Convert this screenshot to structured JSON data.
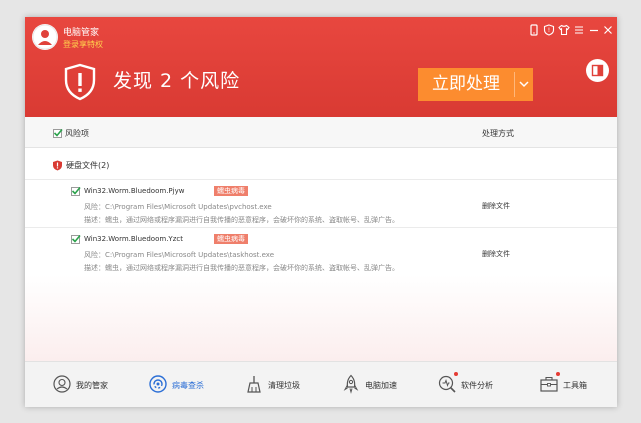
{
  "window": {
    "app_name": "电脑管家",
    "login_text": "登录享特权",
    "headline": "发现 2 个风险",
    "action_label": "立即处理"
  },
  "table": {
    "col_risk": "风险项",
    "col_action": "处理方式",
    "group_label": "硬盘文件(2)",
    "rows": [
      {
        "name": "Win32.Worm.Bluedoom.Pjyw",
        "badge": "蠕虫病毒",
        "path": "风险：C:\\Program Files\\Microsoft Updates\\pvchost.exe",
        "desc": "描述：蠕虫，通过网络或程序漏洞进行自我传播的恶意程序，会破坏你的系统、盗取帐号、乱弹广告。",
        "action": "删除文件",
        "checked": true
      },
      {
        "name": "Win32.Worm.Bluedoom.Yzct",
        "badge": "蠕虫病毒",
        "path": "风险：C:\\Program Files\\Microsoft Updates\\taskhost.exe",
        "desc": "描述：蠕虫，通过网络或程序漏洞进行自我传播的恶意程序，会破坏你的系统、盗取帐号、乱弹广告。",
        "action": "删除文件",
        "checked": true
      }
    ]
  },
  "nav": {
    "items": [
      {
        "label": "我的管家",
        "icon": "butler-icon"
      },
      {
        "label": "病毒查杀",
        "icon": "virus-scan-icon",
        "active": true
      },
      {
        "label": "清理垃圾",
        "icon": "broom-icon"
      },
      {
        "label": "电脑加速",
        "icon": "rocket-icon"
      },
      {
        "label": "软件分析",
        "icon": "magnifier-icon"
      },
      {
        "label": "工具箱",
        "icon": "toolbox-icon"
      }
    ]
  },
  "colors": {
    "header_red": "#e0413a",
    "action_orange": "#fc8c2f",
    "badge": "#ef7f6b",
    "active_blue": "#2c6fd6",
    "check_green": "#2aa24b"
  }
}
